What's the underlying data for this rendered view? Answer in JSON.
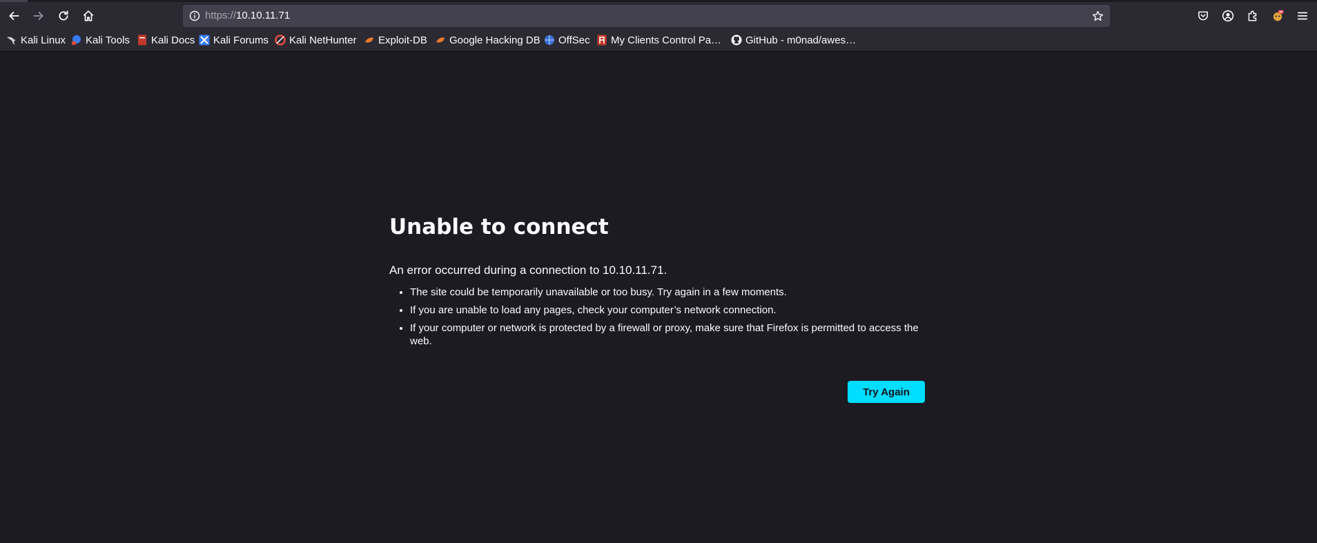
{
  "browser": {
    "url_scheme": "https://",
    "url_host": "10.10.11.71",
    "icons": {
      "back": "arrow-left-icon",
      "forward": "arrow-right-icon",
      "reload": "reload-icon",
      "home": "home-icon",
      "site_info": "info-circle-icon",
      "bookmark_star": "star-icon",
      "pocket": "pocket-icon",
      "account": "account-icon",
      "extensions": "puzzle-icon",
      "extension_badge": "extension-badge-icon",
      "menu": "hamburger-menu-icon"
    }
  },
  "bookmarks": [
    {
      "label": "Kali Linux",
      "icon": "kali-dragon-icon"
    },
    {
      "label": "Kali Tools",
      "icon": "kali-tools-icon"
    },
    {
      "label": "Kali Docs",
      "icon": "kali-docs-icon"
    },
    {
      "label": "Kali Forums",
      "icon": "kali-forums-icon"
    },
    {
      "label": "Kali NetHunter",
      "icon": "nethunter-icon"
    },
    {
      "label": "Exploit-DB",
      "icon": "exploit-db-icon"
    },
    {
      "label": "Google Hacking DB",
      "icon": "ghdb-icon"
    },
    {
      "label": "OffSec",
      "icon": "offsec-icon"
    },
    {
      "label": "My Clients Control Pa…",
      "icon": "control-panel-icon"
    },
    {
      "label": "GitHub - m0nad/awes…",
      "icon": "github-icon"
    }
  ],
  "error_page": {
    "title": "Unable to connect",
    "description": "An error occurred during a connection to 10.10.11.71.",
    "reasons": [
      "The site could be temporarily unavailable or too busy. Try again in a few moments.",
      "If you are unable to load any pages, check your computer’s network connection.",
      "If your computer or network is protected by a firewall or proxy, make sure that Firefox is permitted to access the web."
    ],
    "try_again_label": "Try Again"
  },
  "colors": {
    "page_background": "#1c1b22",
    "toolbar_background": "#2b2a33",
    "urlbar_background": "#42414d",
    "primary_button": "#00ddff",
    "text": "#fbfbfe"
  }
}
